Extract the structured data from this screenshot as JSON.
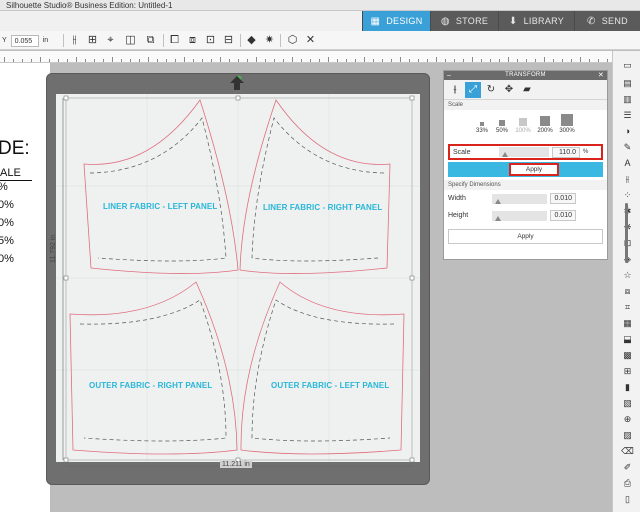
{
  "app": {
    "title": "Silhouette Studio® Business Edition: Untitled-1"
  },
  "nav": {
    "tabs": [
      {
        "label": "DESIGN",
        "icon": "grid-icon",
        "active": true
      },
      {
        "label": "STORE",
        "icon": "store-icon",
        "active": false
      },
      {
        "label": "LIBRARY",
        "icon": "library-icon",
        "active": false
      },
      {
        "label": "SEND",
        "icon": "send-icon",
        "active": false
      }
    ]
  },
  "toolbar": {
    "y_label": "Y",
    "y_value": "0.055",
    "y_unit": "in"
  },
  "document": {
    "heading": "DE:",
    "column_header": "ALE",
    "percentages": [
      "%",
      "0%",
      "0%",
      "5%",
      "0%"
    ]
  },
  "canvas": {
    "width_label": "11.211 in",
    "height_label": "11.792 in",
    "panels": [
      {
        "label": "LINER FABRIC - LEFT PANEL"
      },
      {
        "label": "LINER FABRIC - RIGHT PANEL"
      },
      {
        "label": "OUTER FABRIC - RIGHT PANEL"
      },
      {
        "label": "OUTER FABRIC - LEFT PANEL"
      }
    ]
  },
  "transform": {
    "title": "TRANSFORM",
    "section_scale": "Scale",
    "presets": [
      {
        "label": "33%",
        "dim": false
      },
      {
        "label": "50%",
        "dim": false
      },
      {
        "label": "100%",
        "dim": true
      },
      {
        "label": "200%",
        "dim": false
      },
      {
        "label": "300%",
        "dim": false
      }
    ],
    "scale_label": "Scale",
    "scale_value": "110.0",
    "scale_unit": "%",
    "apply_label": "Apply",
    "section_dimensions": "Specify Dimensions",
    "width_label": "Width",
    "width_value": "0.010",
    "height_label": "Height",
    "height_value": "0.010",
    "apply2_label": "Apply"
  },
  "colors": {
    "accent": "#3aa0d8",
    "highlight": "#d8241c",
    "panel_text": "#29b6d8",
    "cut_line": "#e06d7e"
  }
}
